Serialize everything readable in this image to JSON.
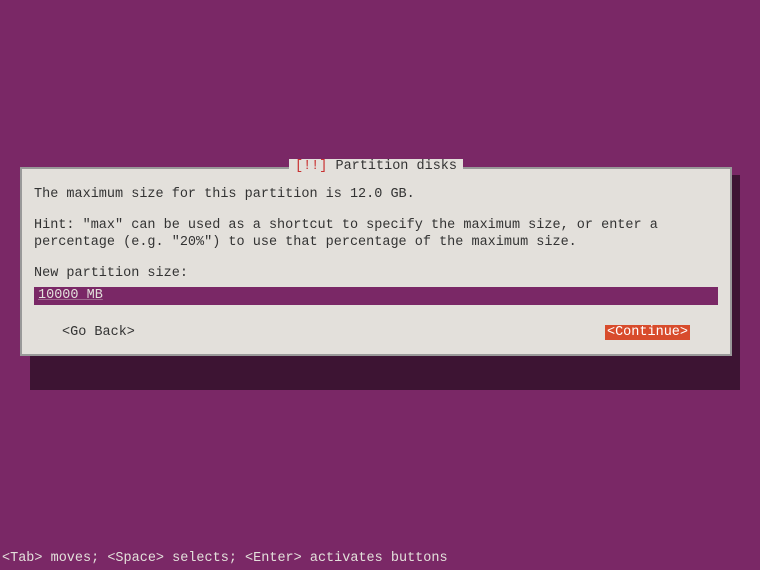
{
  "dialog": {
    "title_prefix": "[!!]",
    "title_text": "Partition disks",
    "info": "The maximum size for this partition is 12.0 GB.",
    "hint": "Hint: \"max\" can be used as a shortcut to specify the maximum size, or enter a percentage (e.g. \"20%\") to use that percentage of the maximum size.",
    "prompt": "New partition size:",
    "input_value": "10000 MB",
    "go_back": "<Go Back>",
    "continue": "<Continue>"
  },
  "footer": {
    "hint": "<Tab> moves; <Space> selects; <Enter> activates buttons"
  }
}
